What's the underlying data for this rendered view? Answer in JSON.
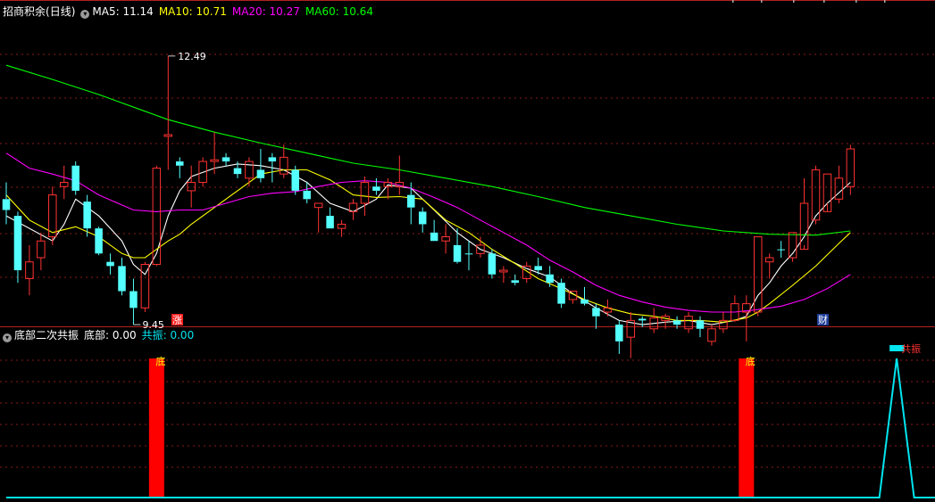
{
  "header": {
    "stock_name": "招商积余",
    "period": "(日线)",
    "ma_labels": [
      {
        "label": "MA5",
        "value": "11.14",
        "color": "#ffffff"
      },
      {
        "label": "MA10",
        "value": "10.71",
        "color": "#ffff00"
      },
      {
        "label": "MA20",
        "value": "10.27",
        "color": "#ff00ff"
      },
      {
        "label": "MA60",
        "value": "10.64",
        "color": "#00ff00"
      }
    ]
  },
  "indicator": {
    "name": "底部二次共振",
    "bottom_label": "底部",
    "bottom_value": "0.00",
    "resonance_label": "共振",
    "resonance_value": "0.00"
  },
  "colors": {
    "background": "#000000",
    "up": "#ff3232",
    "down": "#54ffff",
    "grid": "#8b1a1a",
    "divider": "#b22222",
    "ma5": "#ffffff",
    "ma10": "#ffff00",
    "ma20": "#ff00ff",
    "ma60": "#00ff00",
    "bottom_bar": "#ff0000",
    "resonance_line": "#00e5ee"
  },
  "chart_data": [
    {
      "type": "candlestick",
      "price_range": [
        9.4,
        12.65
      ],
      "candles": [
        [
          10.75,
          10.95,
          10.45,
          10.62
        ],
        [
          10.55,
          10.6,
          9.75,
          9.9
        ],
        [
          9.8,
          10.2,
          9.6,
          10.0
        ],
        [
          10.05,
          10.35,
          9.9,
          10.25
        ],
        [
          10.3,
          10.9,
          10.2,
          10.8
        ],
        [
          10.9,
          11.15,
          10.75,
          10.95
        ],
        [
          11.15,
          11.2,
          10.8,
          10.85
        ],
        [
          10.72,
          10.8,
          10.3,
          10.4
        ],
        [
          10.4,
          10.42,
          10.08,
          10.1
        ],
        [
          10.0,
          10.1,
          9.85,
          9.95
        ],
        [
          9.95,
          10.05,
          9.6,
          9.65
        ],
        [
          9.65,
          9.8,
          9.25,
          9.45
        ],
        [
          9.45,
          10.0,
          9.4,
          9.97
        ],
        [
          9.97,
          11.15,
          9.95,
          11.12
        ],
        [
          11.5,
          12.46,
          11.1,
          11.52
        ],
        [
          11.2,
          11.25,
          11.0,
          11.15
        ],
        [
          10.85,
          11.15,
          10.65,
          10.95
        ],
        [
          10.95,
          11.25,
          10.9,
          11.2
        ],
        [
          11.2,
          11.55,
          11.05,
          11.22
        ],
        [
          11.25,
          11.3,
          11.15,
          11.2
        ],
        [
          11.12,
          11.2,
          11.0,
          11.05
        ],
        [
          11.0,
          11.25,
          10.9,
          11.2
        ],
        [
          11.1,
          11.35,
          10.95,
          11.0
        ],
        [
          11.25,
          11.3,
          10.95,
          11.2
        ],
        [
          11.05,
          11.4,
          11.0,
          11.25
        ],
        [
          11.1,
          11.15,
          10.8,
          10.85
        ],
        [
          10.85,
          10.95,
          10.7,
          10.75
        ],
        [
          10.65,
          10.7,
          10.35,
          10.7
        ],
        [
          10.55,
          10.65,
          10.4,
          10.4
        ],
        [
          10.4,
          10.5,
          10.3,
          10.45
        ],
        [
          10.6,
          10.75,
          10.5,
          10.7
        ],
        [
          10.7,
          11.02,
          10.55,
          10.95
        ],
        [
          10.9,
          11.0,
          10.8,
          10.85
        ],
        [
          10.9,
          11.0,
          10.75,
          10.95
        ],
        [
          10.9,
          11.27,
          10.8,
          10.95
        ],
        [
          10.8,
          10.95,
          10.45,
          10.65
        ],
        [
          10.6,
          10.65,
          10.35,
          10.45
        ],
        [
          10.35,
          10.5,
          10.25,
          10.25
        ],
        [
          10.25,
          10.45,
          10.1,
          10.3
        ],
        [
          10.2,
          10.4,
          9.98,
          10.0
        ],
        [
          10.1,
          10.25,
          9.9,
          10.1
        ],
        [
          10.1,
          10.3,
          10.05,
          10.2
        ],
        [
          10.1,
          10.15,
          9.8,
          9.85
        ],
        [
          9.88,
          9.95,
          9.75,
          9.9
        ],
        [
          9.78,
          9.85,
          9.72,
          9.75
        ],
        [
          9.8,
          10.0,
          9.75,
          9.95
        ],
        [
          9.95,
          10.05,
          9.85,
          9.9
        ],
        [
          9.85,
          9.95,
          9.7,
          9.75
        ],
        [
          9.75,
          9.8,
          9.45,
          9.5
        ],
        [
          9.55,
          9.65,
          9.5,
          9.65
        ],
        [
          9.55,
          9.7,
          9.48,
          9.5
        ],
        [
          9.45,
          9.5,
          9.2,
          9.35
        ],
        [
          9.4,
          9.55,
          9.35,
          9.45
        ],
        [
          9.25,
          9.3,
          8.9,
          9.05
        ],
        [
          9.1,
          9.4,
          8.85,
          9.3
        ],
        [
          9.32,
          9.35,
          9.22,
          9.3
        ],
        [
          9.2,
          9.45,
          9.15,
          9.33
        ],
        [
          9.3,
          9.38,
          9.2,
          9.35
        ],
        [
          9.3,
          9.35,
          9.2,
          9.25
        ],
        [
          9.2,
          9.4,
          9.15,
          9.35
        ],
        [
          9.3,
          9.35,
          9.1,
          9.2
        ],
        [
          9.05,
          9.25,
          9.0,
          9.2
        ],
        [
          9.2,
          9.4,
          9.15,
          9.3
        ],
        [
          9.3,
          9.6,
          9.28,
          9.5
        ],
        [
          9.4,
          9.6,
          9.05,
          9.5
        ],
        [
          9.4,
          10.3,
          9.35,
          10.3
        ],
        [
          10.0,
          10.1,
          9.8,
          10.05
        ],
        [
          10.15,
          10.25,
          10.05,
          10.15
        ],
        [
          10.05,
          10.35,
          10.0,
          10.35
        ],
        [
          10.15,
          11.0,
          10.2,
          10.7
        ],
        [
          10.5,
          11.15,
          10.45,
          11.1
        ],
        [
          10.6,
          11.05,
          10.7,
          11.05
        ],
        [
          10.75,
          11.15,
          10.7,
          11.0
        ],
        [
          10.9,
          11.4,
          10.8,
          11.35
        ]
      ]
    },
    {
      "type": "line",
      "series": [
        {
          "name": "MA5",
          "color": "#ffffff",
          "points": [
            [
              0,
              10.55
            ],
            [
              4,
              10.25
            ],
            [
              5,
              10.45
            ],
            [
              6,
              10.75
            ],
            [
              8,
              10.55
            ],
            [
              10,
              10.25
            ],
            [
              11,
              9.97
            ],
            [
              12,
              9.85
            ],
            [
              13,
              10.1
            ],
            [
              14,
              10.55
            ],
            [
              15,
              10.85
            ],
            [
              16,
              11.02
            ],
            [
              18,
              11.12
            ],
            [
              20,
              11.17
            ],
            [
              22,
              11.15
            ],
            [
              24,
              11.1
            ],
            [
              26,
              10.95
            ],
            [
              28,
              10.7
            ],
            [
              30,
              10.6
            ],
            [
              32,
              10.75
            ],
            [
              33,
              10.92
            ],
            [
              35,
              10.88
            ],
            [
              37,
              10.62
            ],
            [
              39,
              10.35
            ],
            [
              41,
              10.15
            ],
            [
              43,
              10.05
            ],
            [
              45,
              9.92
            ],
            [
              47,
              9.82
            ],
            [
              49,
              9.62
            ],
            [
              51,
              9.45
            ],
            [
              53,
              9.3
            ],
            [
              55,
              9.25
            ],
            [
              57,
              9.28
            ],
            [
              59,
              9.3
            ],
            [
              61,
              9.25
            ],
            [
              63,
              9.3
            ],
            [
              64,
              9.35
            ],
            [
              65,
              9.6
            ],
            [
              66,
              9.75
            ],
            [
              67,
              9.95
            ],
            [
              68,
              10.1
            ],
            [
              69,
              10.3
            ],
            [
              70,
              10.55
            ],
            [
              71,
              10.7
            ],
            [
              73,
              10.95
            ]
          ]
        },
        {
          "name": "MA10",
          "color": "#ffff00",
          "points": [
            [
              0,
              10.8
            ],
            [
              2,
              10.5
            ],
            [
              4,
              10.35
            ],
            [
              6,
              10.42
            ],
            [
              8,
              10.3
            ],
            [
              10,
              10.1
            ],
            [
              11,
              10.05
            ],
            [
              12,
              10.05
            ],
            [
              13,
              10.15
            ],
            [
              14,
              10.25
            ],
            [
              15,
              10.33
            ],
            [
              16,
              10.45
            ],
            [
              18,
              10.65
            ],
            [
              20,
              10.85
            ],
            [
              22,
              11.05
            ],
            [
              24,
              11.1
            ],
            [
              26,
              11.1
            ],
            [
              28,
              10.98
            ],
            [
              30,
              10.8
            ],
            [
              32,
              10.77
            ],
            [
              34,
              10.78
            ],
            [
              36,
              10.75
            ],
            [
              38,
              10.5
            ],
            [
              40,
              10.35
            ],
            [
              42,
              10.15
            ],
            [
              44,
              9.98
            ],
            [
              46,
              9.8
            ],
            [
              48,
              9.68
            ],
            [
              50,
              9.55
            ],
            [
              52,
              9.45
            ],
            [
              54,
              9.38
            ],
            [
              56,
              9.35
            ],
            [
              58,
              9.3
            ],
            [
              60,
              9.3
            ],
            [
              62,
              9.28
            ],
            [
              64,
              9.33
            ],
            [
              65,
              9.4
            ],
            [
              66,
              9.5
            ],
            [
              68,
              9.72
            ],
            [
              70,
              9.95
            ],
            [
              72,
              10.22
            ],
            [
              73,
              10.35
            ]
          ]
        },
        {
          "name": "MA20",
          "color": "#ff00ff",
          "points": [
            [
              0,
              11.3
            ],
            [
              2,
              11.12
            ],
            [
              4,
              11.05
            ],
            [
              6,
              10.97
            ],
            [
              8,
              10.8
            ],
            [
              10,
              10.68
            ],
            [
              11,
              10.62
            ],
            [
              13,
              10.6
            ],
            [
              15,
              10.62
            ],
            [
              17,
              10.62
            ],
            [
              19,
              10.7
            ],
            [
              21,
              10.78
            ],
            [
              23,
              10.82
            ],
            [
              25,
              10.84
            ],
            [
              27,
              10.9
            ],
            [
              29,
              10.95
            ],
            [
              31,
              10.97
            ],
            [
              33,
              10.95
            ],
            [
              35,
              10.88
            ],
            [
              37,
              10.77
            ],
            [
              39,
              10.65
            ],
            [
              41,
              10.5
            ],
            [
              43,
              10.35
            ],
            [
              45,
              10.2
            ],
            [
              47,
              10.02
            ],
            [
              49,
              9.88
            ],
            [
              51,
              9.72
            ],
            [
              53,
              9.6
            ],
            [
              55,
              9.52
            ],
            [
              57,
              9.46
            ],
            [
              59,
              9.42
            ],
            [
              61,
              9.4
            ],
            [
              63,
              9.4
            ],
            [
              65,
              9.43
            ],
            [
              67,
              9.47
            ],
            [
              69,
              9.55
            ],
            [
              71,
              9.68
            ],
            [
              73,
              9.85
            ]
          ]
        },
        {
          "name": "MA60",
          "color": "#00ff00",
          "points": [
            [
              0,
              12.35
            ],
            [
              4,
              12.18
            ],
            [
              8,
              12.0
            ],
            [
              12,
              11.8
            ],
            [
              14,
              11.7
            ],
            [
              18,
              11.55
            ],
            [
              22,
              11.42
            ],
            [
              26,
              11.3
            ],
            [
              30,
              11.18
            ],
            [
              34,
              11.1
            ],
            [
              38,
              11.0
            ],
            [
              42,
              10.9
            ],
            [
              46,
              10.78
            ],
            [
              50,
              10.65
            ],
            [
              54,
              10.55
            ],
            [
              58,
              10.45
            ],
            [
              62,
              10.37
            ],
            [
              66,
              10.33
            ],
            [
              70,
              10.32
            ],
            [
              73,
              10.37
            ]
          ]
        }
      ]
    },
    {
      "type": "bar",
      "series": [
        {
          "name": "底部",
          "color": "#ff0000",
          "points": [
            [
              13,
              1
            ],
            [
              64,
              1
            ]
          ]
        }
      ],
      "labels": [
        {
          "x": 13,
          "text": "底"
        },
        {
          "x": 64,
          "text": "底"
        }
      ]
    },
    {
      "type": "line",
      "series": [
        {
          "name": "共振",
          "color": "#00e5ee",
          "points": [
            [
              0,
              0
            ],
            [
              75.5,
              0
            ],
            [
              77,
              1
            ],
            [
              78.5,
              0
            ],
            [
              84,
              0
            ]
          ]
        }
      ],
      "labels": [
        {
          "x": 77,
          "text": "共振"
        }
      ]
    }
  ],
  "annotations": {
    "high_label": "12.49",
    "low_label": "9.45",
    "marker_up": "涨",
    "marker_finance": "财"
  }
}
